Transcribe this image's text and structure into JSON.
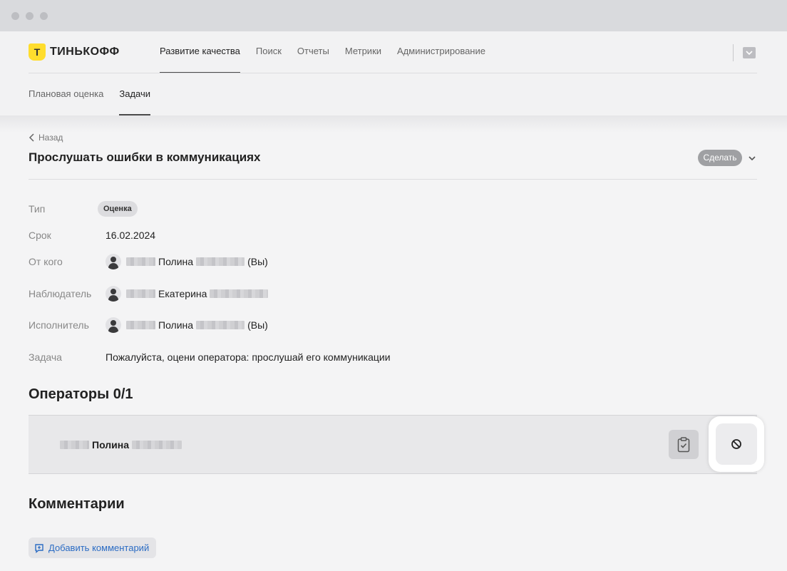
{
  "brand": {
    "logo_letter": "Т",
    "name": "ТИНЬКОФФ",
    "color": "#ffdd2d"
  },
  "topnav": [
    {
      "label": "Развитие качества",
      "active": true
    },
    {
      "label": "Поиск"
    },
    {
      "label": "Отчеты"
    },
    {
      "label": "Метрики"
    },
    {
      "label": "Администрирование"
    }
  ],
  "header_icon": "inbox-icon",
  "subnav": [
    {
      "label": "Плановая оценка"
    },
    {
      "label": "Задачи",
      "active": true
    }
  ],
  "back_label": "Назад",
  "task": {
    "title": "Прослушать ошибки в коммуникациях",
    "action_label": "Сделать",
    "fields": {
      "type": {
        "label": "Тип",
        "value": "Оценка"
      },
      "deadline": {
        "label": "Срок",
        "value": "16.02.2024"
      },
      "from": {
        "label": "От кого",
        "first_name": "Полина",
        "suffix": "(Вы)"
      },
      "observer": {
        "label": "Наблюдатель",
        "first_name": "Екатерина"
      },
      "assignee": {
        "label": "Исполнитель",
        "first_name": "Полина",
        "suffix": "(Вы)"
      },
      "task_text": {
        "label": "Задача",
        "value": "Пожалуйста, оцени оператора: прослушай его коммуникации"
      }
    }
  },
  "operators": {
    "title": "Операторы 0/1",
    "items": [
      {
        "first_name": "Полина"
      }
    ]
  },
  "comments": {
    "title": "Комментарии",
    "add_label": "Добавить комментарий"
  },
  "colors": {
    "accent_link": "#2b6cc4",
    "action_button": "#9fa0a3"
  }
}
